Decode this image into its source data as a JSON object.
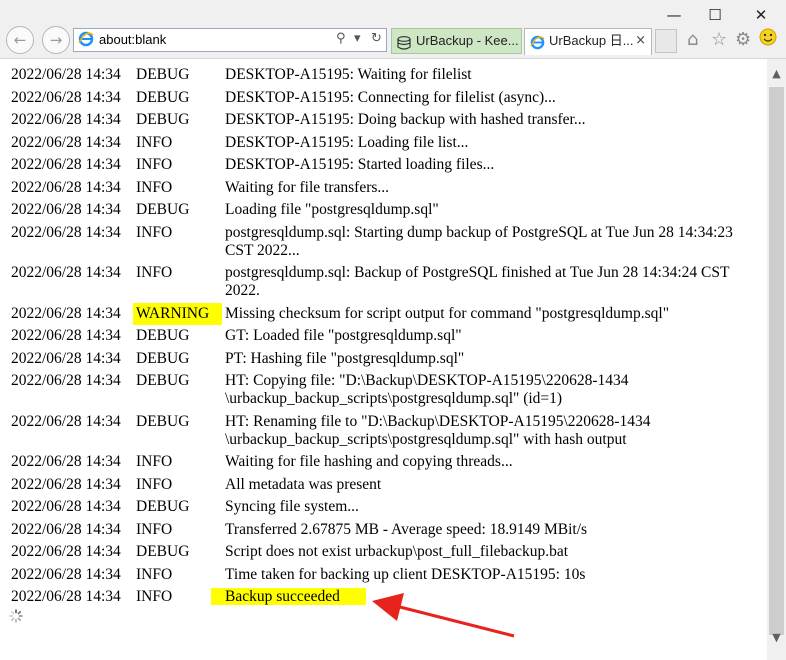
{
  "window": {
    "minimize_glyph": "—",
    "maximize_glyph": "☐",
    "close_glyph": "✕"
  },
  "address_bar": {
    "url": "about:blank",
    "search_glyph": "⚲",
    "dropdown_glyph": "▾",
    "refresh_glyph": "↻"
  },
  "tabs": [
    {
      "label": "UrBackup - Kee...",
      "icon": "database-icon"
    },
    {
      "label": "UrBackup 日...",
      "icon": "ie-icon",
      "close": "×"
    }
  ],
  "toolbar_icons": [
    "home-icon",
    "star-icon",
    "gear-icon",
    "smiley-icon"
  ],
  "log": [
    {
      "date": "2022/06/28 14:34",
      "level": "DEBUG",
      "msg": "DESKTOP-A15195: Waiting for filelist"
    },
    {
      "date": "2022/06/28 14:34",
      "level": "DEBUG",
      "msg": "DESKTOP-A15195: Connecting for filelist (async)..."
    },
    {
      "date": "2022/06/28 14:34",
      "level": "DEBUG",
      "msg": "DESKTOP-A15195: Doing backup with hashed transfer..."
    },
    {
      "date": "2022/06/28 14:34",
      "level": "INFO",
      "msg": "DESKTOP-A15195: Loading file list..."
    },
    {
      "date": "2022/06/28 14:34",
      "level": "INFO",
      "msg": "DESKTOP-A15195: Started loading files..."
    },
    {
      "date": "2022/06/28 14:34",
      "level": "INFO",
      "msg": "Waiting for file transfers..."
    },
    {
      "date": "2022/06/28 14:34",
      "level": "DEBUG",
      "msg": "Loading file \"postgresqldump.sql\""
    },
    {
      "date": "2022/06/28 14:34",
      "level": "INFO",
      "msg": "postgresqldump.sql: Starting dump backup of PostgreSQL at Tue Jun 28 14:34:23 CST 2022..."
    },
    {
      "date": "2022/06/28 14:34",
      "level": "INFO",
      "msg": "postgresqldump.sql: Backup of PostgreSQL finished at Tue Jun 28 14:34:24 CST 2022."
    },
    {
      "date": "2022/06/28 14:34",
      "level": "WARNING",
      "msg": "Missing checksum for script output for command \"postgresqldump.sql\""
    },
    {
      "date": "2022/06/28 14:34",
      "level": "DEBUG",
      "msg": "GT: Loaded file \"postgresqldump.sql\""
    },
    {
      "date": "2022/06/28 14:34",
      "level": "DEBUG",
      "msg": "PT: Hashing file \"postgresqldump.sql\""
    },
    {
      "date": "2022/06/28 14:34",
      "level": "DEBUG",
      "msg": "HT: Copying file: \"D:\\Backup\\DESKTOP-A15195\\220628-1434 \\urbackup_backup_scripts\\postgresqldump.sql\" (id=1)"
    },
    {
      "date": "2022/06/28 14:34",
      "level": "DEBUG",
      "msg": "HT: Renaming file to \"D:\\Backup\\DESKTOP-A15195\\220628-1434 \\urbackup_backup_scripts\\postgresqldump.sql\" with hash output"
    },
    {
      "date": "2022/06/28 14:34",
      "level": "INFO",
      "msg": "Waiting for file hashing and copying threads..."
    },
    {
      "date": "2022/06/28 14:34",
      "level": "INFO",
      "msg": "All metadata was present"
    },
    {
      "date": "2022/06/28 14:34",
      "level": "DEBUG",
      "msg": "Syncing file system..."
    },
    {
      "date": "2022/06/28 14:34",
      "level": "INFO",
      "msg": "Transferred 2.67875 MB - Average speed: 18.9149 MBit/s"
    },
    {
      "date": "2022/06/28 14:34",
      "level": "DEBUG",
      "msg": "Script does not exist urbackup\\post_full_filebackup.bat"
    },
    {
      "date": "2022/06/28 14:34",
      "level": "INFO",
      "msg": "Time taken for backing up client DESKTOP-A15195: 10s"
    },
    {
      "date": "2022/06/28 14:34",
      "level": "INFO",
      "msg": "Backup succeeded",
      "highlight": true
    }
  ],
  "scrollbar": {
    "up": "▲",
    "down": "▼"
  },
  "colors": {
    "highlight": "#ffff00",
    "annotation_arrow": "#e8231e",
    "tab_active_green": "#cde6c3"
  }
}
